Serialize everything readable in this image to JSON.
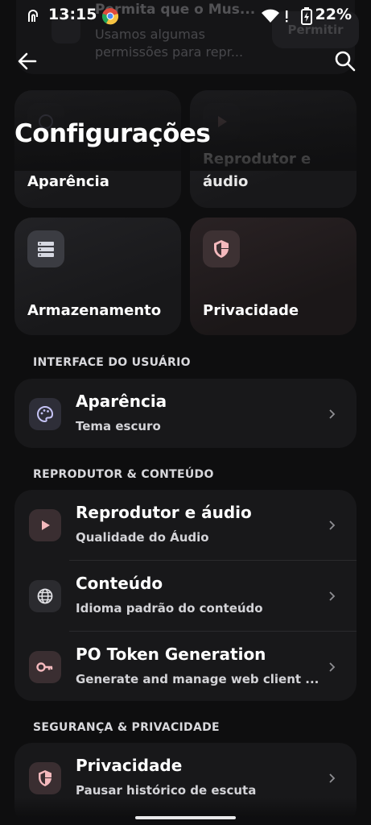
{
  "status_bar": {
    "time": "13:15",
    "battery": "22%"
  },
  "notification": {
    "title": "Permita que o Mus...",
    "body": "Usamos algumas permissões para repr...",
    "button": "Permitir"
  },
  "header": {
    "title": "Configurações",
    "back_icon": "arrow-left-icon",
    "search_icon": "search-icon"
  },
  "tiles": [
    {
      "label": "Aparência",
      "icon": "palette-icon"
    },
    {
      "label": "Reprodutor e áudio",
      "icon": "play-icon"
    },
    {
      "label": "Armazenamento",
      "icon": "storage-icon"
    },
    {
      "label": "Privacidade",
      "icon": "shield-icon"
    }
  ],
  "sections": [
    {
      "title": "INTERFACE DO USUÁRIO",
      "items": [
        {
          "title": "Aparência",
          "subtitle": "Tema escuro",
          "icon": "palette-icon"
        }
      ]
    },
    {
      "title": "REPRODUTOR & CONTEÚDO",
      "items": [
        {
          "title": "Reprodutor e áudio",
          "subtitle": "Qualidade do Áudio",
          "icon": "play-icon"
        },
        {
          "title": "Conteúdo",
          "subtitle": "Idioma padrão do conteúdo",
          "icon": "globe-icon"
        },
        {
          "title": "PO Token Generation",
          "subtitle": "Generate and manage web client ...",
          "icon": "key-icon"
        }
      ]
    },
    {
      "title": "SEGURANÇA & PRIVACIDADE",
      "items": [
        {
          "title": "Privacidade",
          "subtitle": "Pausar histórico de escuta",
          "icon": "shield-icon"
        }
      ]
    }
  ],
  "colors": {
    "background": "#0e0e0f",
    "card": "#18181a",
    "accent_pink": "#f4b9bd",
    "accent_lavender": "#c5c3f5"
  }
}
